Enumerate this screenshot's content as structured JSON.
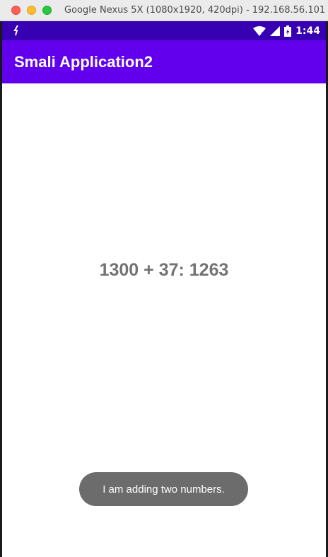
{
  "window": {
    "title": "Google Nexus 5X (1080x1920, 420dpi) - 192.168.56.101 -"
  },
  "status_bar": {
    "time": "1:44",
    "icons": [
      "sync-icon",
      "wifi-icon",
      "signal-icon",
      "battery-icon"
    ]
  },
  "app_bar": {
    "title": "Smali Application2"
  },
  "main": {
    "result": "1300 + 37: 1263"
  },
  "toast": {
    "message": "I am adding two numbers."
  },
  "colors": {
    "status_bar": "#3700b3",
    "app_bar": "#6200ee",
    "result_text": "#737373",
    "toast_bg": "#6c6c6c"
  }
}
